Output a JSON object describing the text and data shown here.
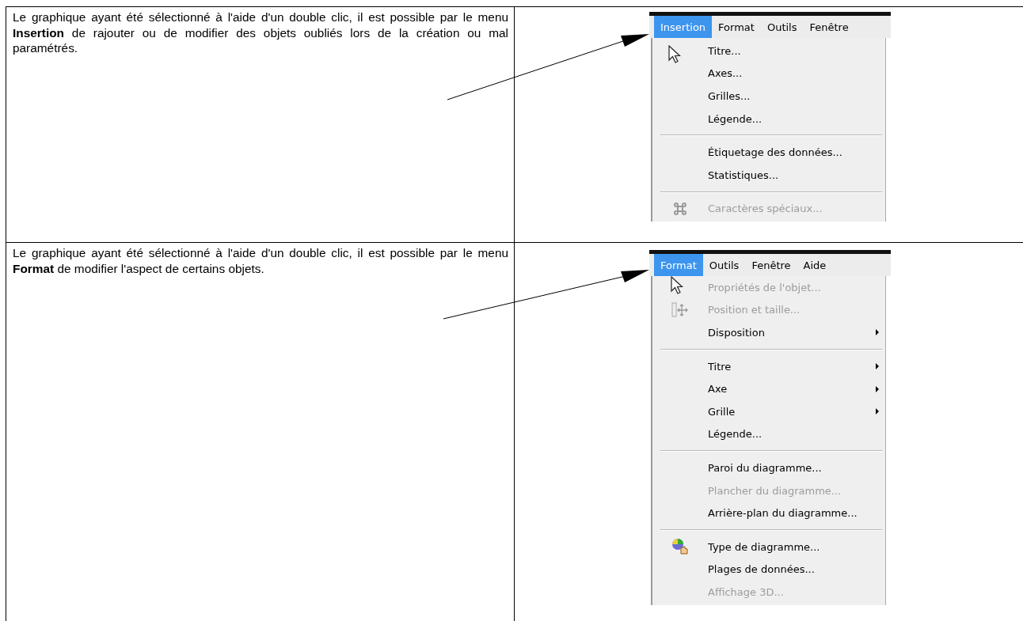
{
  "rows": [
    {
      "text": "Le graphique ayant été sélectionné à l'aide d'un double clic, il est possible par le menu **Insertion** de rajouter ou de modifier des objets oubliés lors de la création ou mal paramétrés.",
      "menubar": [
        {
          "label": "Insertion",
          "selected": true
        },
        {
          "label": "Format",
          "selected": false
        },
        {
          "label": "Outils",
          "selected": false
        },
        {
          "label": "Fenêtre",
          "selected": false
        }
      ],
      "items": [
        {
          "kind": "item",
          "label": "Titre...",
          "disabled": false,
          "submenu": false
        },
        {
          "kind": "item",
          "label": "Axes...",
          "disabled": false,
          "submenu": false
        },
        {
          "kind": "item",
          "label": "Grilles...",
          "disabled": false,
          "submenu": false
        },
        {
          "kind": "item",
          "label": "Légende...",
          "disabled": false,
          "submenu": false
        },
        {
          "kind": "separator"
        },
        {
          "kind": "item",
          "label": "Étiquetage des données...",
          "disabled": false,
          "submenu": false
        },
        {
          "kind": "item",
          "label": "Statistiques...",
          "disabled": false,
          "submenu": false
        },
        {
          "kind": "separator"
        },
        {
          "kind": "item",
          "label": "Caractères spéciaux...",
          "disabled": true,
          "submenu": false
        }
      ]
    },
    {
      "text": "Le graphique ayant été sélectionné à l'aide d'un double clic, il est possible par le menu **Format** de modifier l'aspect de certains objets.",
      "menubar": [
        {
          "label": "Format",
          "selected": true
        },
        {
          "label": "Outils",
          "selected": false
        },
        {
          "label": "Fenêtre",
          "selected": false
        },
        {
          "label": "Aide",
          "selected": false
        }
      ],
      "items": [
        {
          "kind": "item",
          "label": "Propriétés de l'objet...",
          "disabled": true,
          "submenu": false
        },
        {
          "kind": "item",
          "label": "Position et taille...",
          "disabled": true,
          "submenu": false
        },
        {
          "kind": "item",
          "label": "Disposition",
          "disabled": false,
          "submenu": true
        },
        {
          "kind": "separator"
        },
        {
          "kind": "item",
          "label": "Titre",
          "disabled": false,
          "submenu": true
        },
        {
          "kind": "item",
          "label": "Axe",
          "disabled": false,
          "submenu": true
        },
        {
          "kind": "item",
          "label": "Grille",
          "disabled": false,
          "submenu": true
        },
        {
          "kind": "item",
          "label": "Légende...",
          "disabled": false,
          "submenu": false
        },
        {
          "kind": "separator"
        },
        {
          "kind": "item",
          "label": "Paroi du diagramme...",
          "disabled": false,
          "submenu": false
        },
        {
          "kind": "item",
          "label": "Plancher du diagramme...",
          "disabled": true,
          "submenu": false
        },
        {
          "kind": "item",
          "label": "Arrière-plan du diagramme...",
          "disabled": false,
          "submenu": false
        },
        {
          "kind": "separator"
        },
        {
          "kind": "item",
          "label": "Type de diagramme...",
          "disabled": false,
          "submenu": false
        },
        {
          "kind": "item",
          "label": "Plages de données...",
          "disabled": false,
          "submenu": false
        },
        {
          "kind": "item",
          "label": "Affichage 3D...",
          "disabled": true,
          "submenu": false
        }
      ]
    }
  ]
}
